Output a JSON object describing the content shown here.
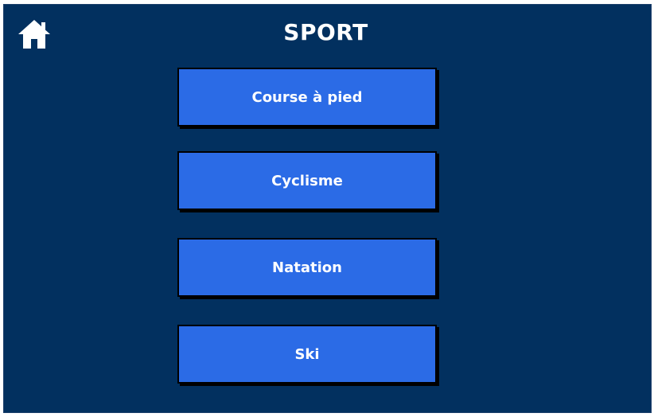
{
  "header": {
    "title": "SPORT",
    "home_icon": "home-icon"
  },
  "sports": [
    {
      "label": "Course à pied"
    },
    {
      "label": "Cyclisme"
    },
    {
      "label": "Natation"
    },
    {
      "label": "Ski"
    }
  ],
  "colors": {
    "background": "#02305f",
    "button": "#2b6be6",
    "text": "#ffffff",
    "button_border": "#000000"
  }
}
